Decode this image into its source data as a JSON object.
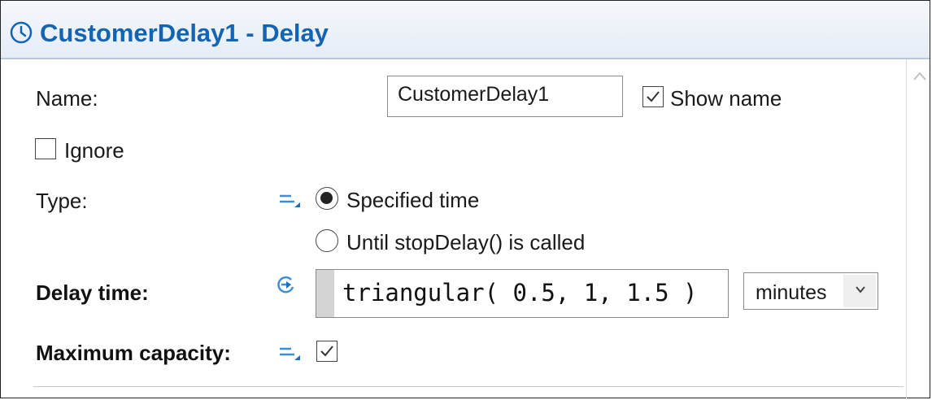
{
  "panel": {
    "title": "CustomerDelay1 - Delay",
    "title_color": "#1464b4",
    "title_icon": "clock-icon"
  },
  "name_row": {
    "label": "Name:",
    "value": "CustomerDelay1",
    "show_name_label": "Show name",
    "show_name_checked": true
  },
  "ignore": {
    "label": "Ignore",
    "checked": false
  },
  "type_row": {
    "label": "Type:",
    "icon": "static-value-icon",
    "options": [
      {
        "label": "Specified time",
        "selected": true
      },
      {
        "label": "Until stopDelay() is called",
        "selected": false
      }
    ]
  },
  "delay_time": {
    "label": "Delay time:",
    "icon": "dynamic-value-icon",
    "expression": "triangular( 0.5, 1, 1.5 )",
    "unit": "minutes"
  },
  "max_capacity": {
    "label": "Maximum capacity:",
    "icon": "static-value-icon",
    "checked": true
  }
}
